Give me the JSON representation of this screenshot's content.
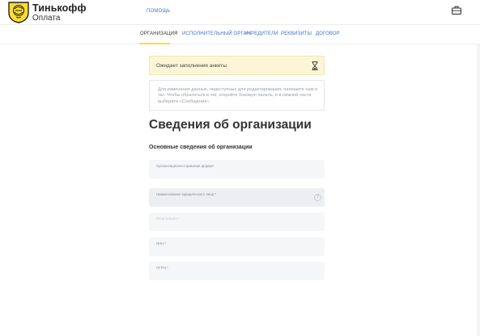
{
  "brand": {
    "title": "Тинькофф",
    "subtitle": "Оплата"
  },
  "header": {
    "help_label": "ПОМОЩЬ",
    "briefcase_icon": "briefcase-icon"
  },
  "tabs": [
    {
      "label": "ОРГАНИЗАЦИЯ",
      "active": true
    },
    {
      "label": "ИСПОЛНИТЕЛЬНЫЙ ОРГАН",
      "active": false
    },
    {
      "label": "УЧРЕДИТЕЛИ",
      "active": false
    },
    {
      "label": "РЕКВИЗИТЫ",
      "active": false
    },
    {
      "label": "ДОГОВОР",
      "active": false
    }
  ],
  "notice": {
    "text": "Ожидает заполнения анкеты",
    "icon": "hourglass-icon"
  },
  "info": {
    "text": "Для изменения данных, недоступных для редактирования, напишите нам в чат. Чтобы обратиться в чат, откройте боковую панель, и в нижней части выберите «Сообщения»"
  },
  "page_title": "Сведения об организации",
  "section_title": "Основные сведения об организации",
  "fields": [
    {
      "label": "Организационно-правовая форма*"
    },
    {
      "label": "Наименование юридического лица *"
    },
    {
      "label": "Регистрация *"
    },
    {
      "label": "ИНН *"
    },
    {
      "label": "ОГРН *"
    }
  ],
  "colors": {
    "accent": "#ffdd2d",
    "link": "#3b75c7",
    "notice_bg": "#fdf6d6",
    "field_bg": "#f5f6f8"
  }
}
